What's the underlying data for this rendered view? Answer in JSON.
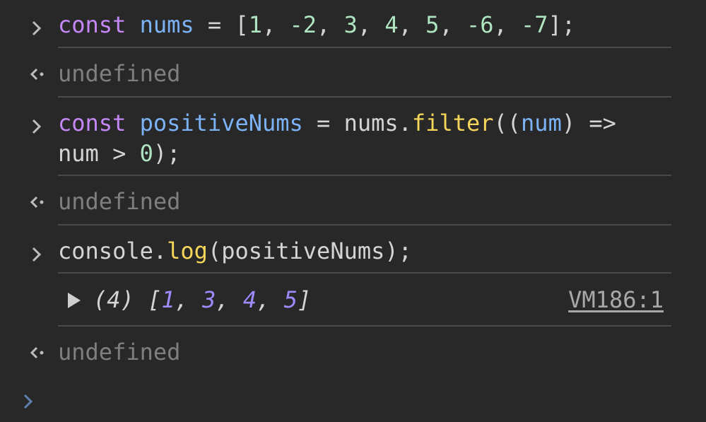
{
  "entries": [
    {
      "type": "input",
      "lines": [
        [
          {
            "t": "const",
            "c": "kw"
          },
          {
            "t": " ",
            "c": "punc"
          },
          {
            "t": "nums",
            "c": "var"
          },
          {
            "t": " = [",
            "c": "punc"
          },
          {
            "t": "1",
            "c": "num"
          },
          {
            "t": ", ",
            "c": "punc"
          },
          {
            "t": "-2",
            "c": "num"
          },
          {
            "t": ", ",
            "c": "punc"
          },
          {
            "t": "3",
            "c": "num"
          },
          {
            "t": ", ",
            "c": "punc"
          },
          {
            "t": "4",
            "c": "num"
          },
          {
            "t": ", ",
            "c": "punc"
          },
          {
            "t": "5",
            "c": "num"
          },
          {
            "t": ", ",
            "c": "punc"
          },
          {
            "t": "-6",
            "c": "num"
          },
          {
            "t": ", ",
            "c": "punc"
          },
          {
            "t": "-7",
            "c": "num"
          },
          {
            "t": "];",
            "c": "punc"
          }
        ]
      ]
    },
    {
      "type": "result",
      "text": "undefined"
    },
    {
      "type": "input",
      "lines": [
        [
          {
            "t": "const",
            "c": "kw"
          },
          {
            "t": " ",
            "c": "punc"
          },
          {
            "t": "positiveNums",
            "c": "var"
          },
          {
            "t": " = nums.",
            "c": "punc"
          },
          {
            "t": "filter",
            "c": "fn"
          },
          {
            "t": "((",
            "c": "punc"
          },
          {
            "t": "num",
            "c": "var"
          },
          {
            "t": ") =>",
            "c": "punc"
          }
        ],
        [
          {
            "t": "num > ",
            "c": "punc"
          },
          {
            "t": "0",
            "c": "num"
          },
          {
            "t": ");",
            "c": "punc"
          }
        ]
      ]
    },
    {
      "type": "result",
      "text": "undefined"
    },
    {
      "type": "input",
      "lines": [
        [
          {
            "t": "console.",
            "c": "punc"
          },
          {
            "t": "log",
            "c": "fn"
          },
          {
            "t": "(positiveNums);",
            "c": "punc"
          }
        ]
      ]
    },
    {
      "type": "log",
      "count_label": "(4) [",
      "values": [
        "1",
        "3",
        "4",
        "5"
      ],
      "close": "]",
      "source": "VM186:1"
    },
    {
      "type": "result",
      "text": "undefined"
    }
  ],
  "icons": {
    "input_prompt": "chevron-right-icon",
    "result_prompt": "return-arrow-icon",
    "expand": "expand-triangle-icon",
    "empty_prompt": "chevron-right-icon"
  },
  "colors": {
    "background": "#282828",
    "keyword": "#c586f6",
    "variable": "#7cb3f6",
    "number": "#aee5c0",
    "function": "#f5d55a",
    "muted": "#7f7f7f",
    "active_prompt": "#5e7fb0"
  }
}
